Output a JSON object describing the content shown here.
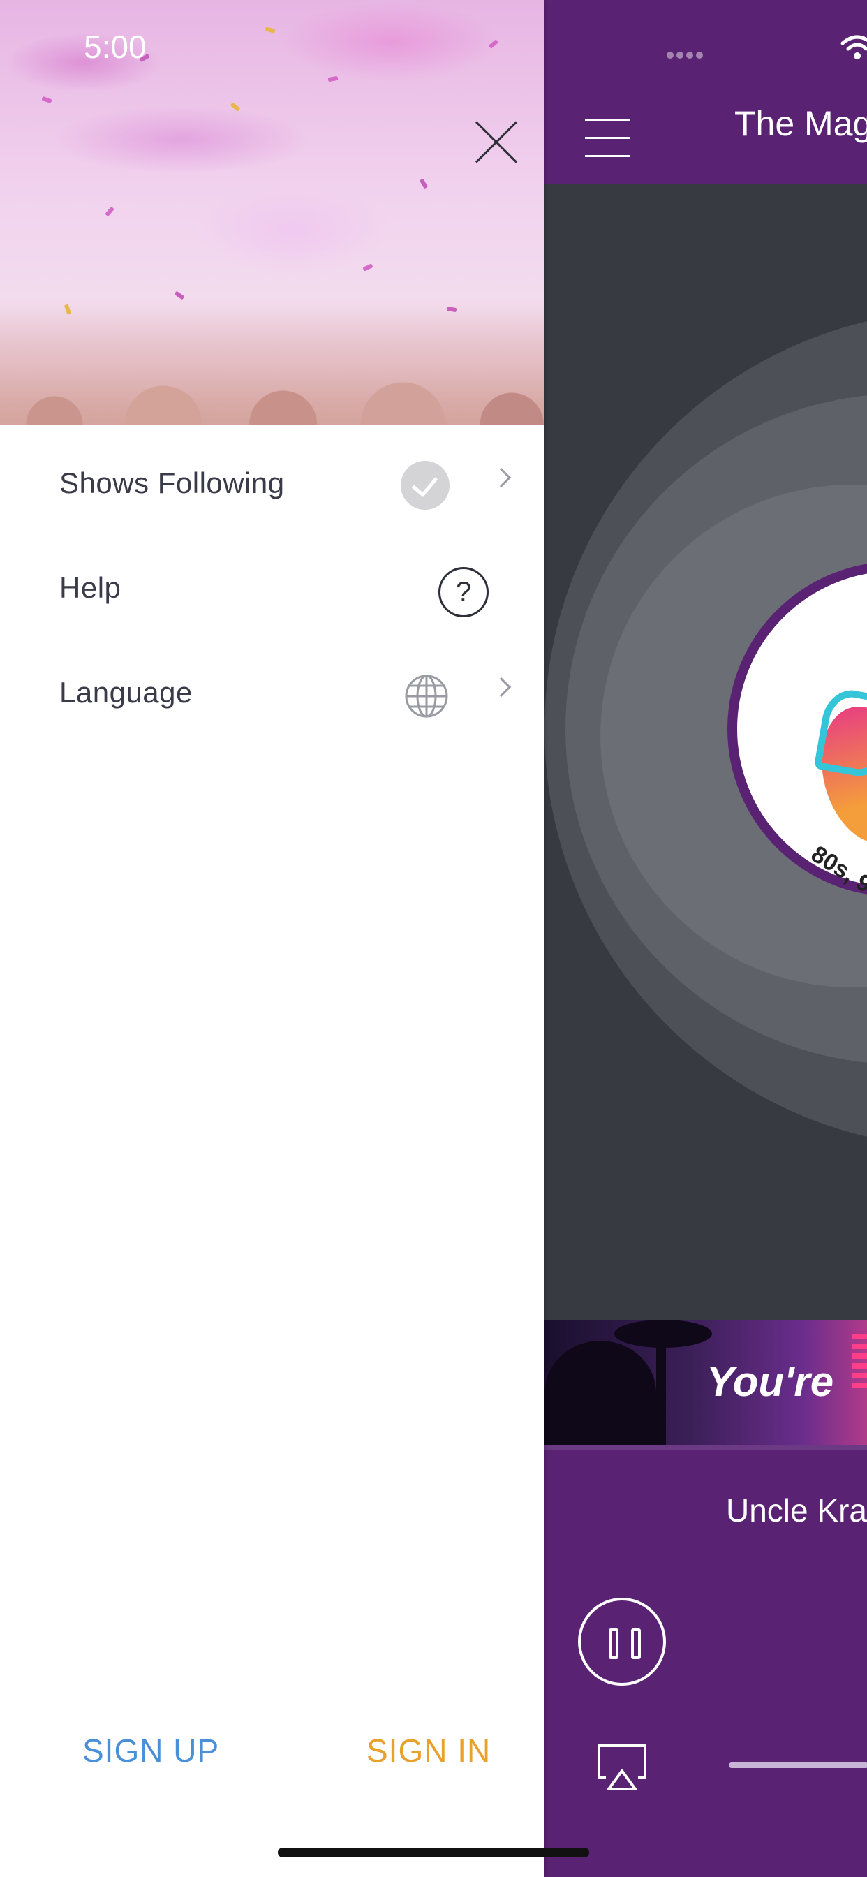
{
  "status_bar": {
    "time": "5:00"
  },
  "app": {
    "station_title": "The Mag",
    "banner_text": "You're",
    "now_playing": "Uncle Kra",
    "album_tagline": "80s, 9"
  },
  "drawer": {
    "menu_items": [
      {
        "label": "Shows Following",
        "icon": "check-circle-icon"
      },
      {
        "label": "Help",
        "icon": "help-circle-icon",
        "icon_text": "?"
      },
      {
        "label": "Language",
        "icon": "globe-icon"
      }
    ],
    "sign_up_label": "SIGN UP",
    "sign_in_label": "SIGN IN"
  },
  "colors": {
    "brand_purple": "#5a2273",
    "sign_up": "#4a90d9",
    "sign_in": "#e8a22c",
    "album_background": "#373a41"
  }
}
